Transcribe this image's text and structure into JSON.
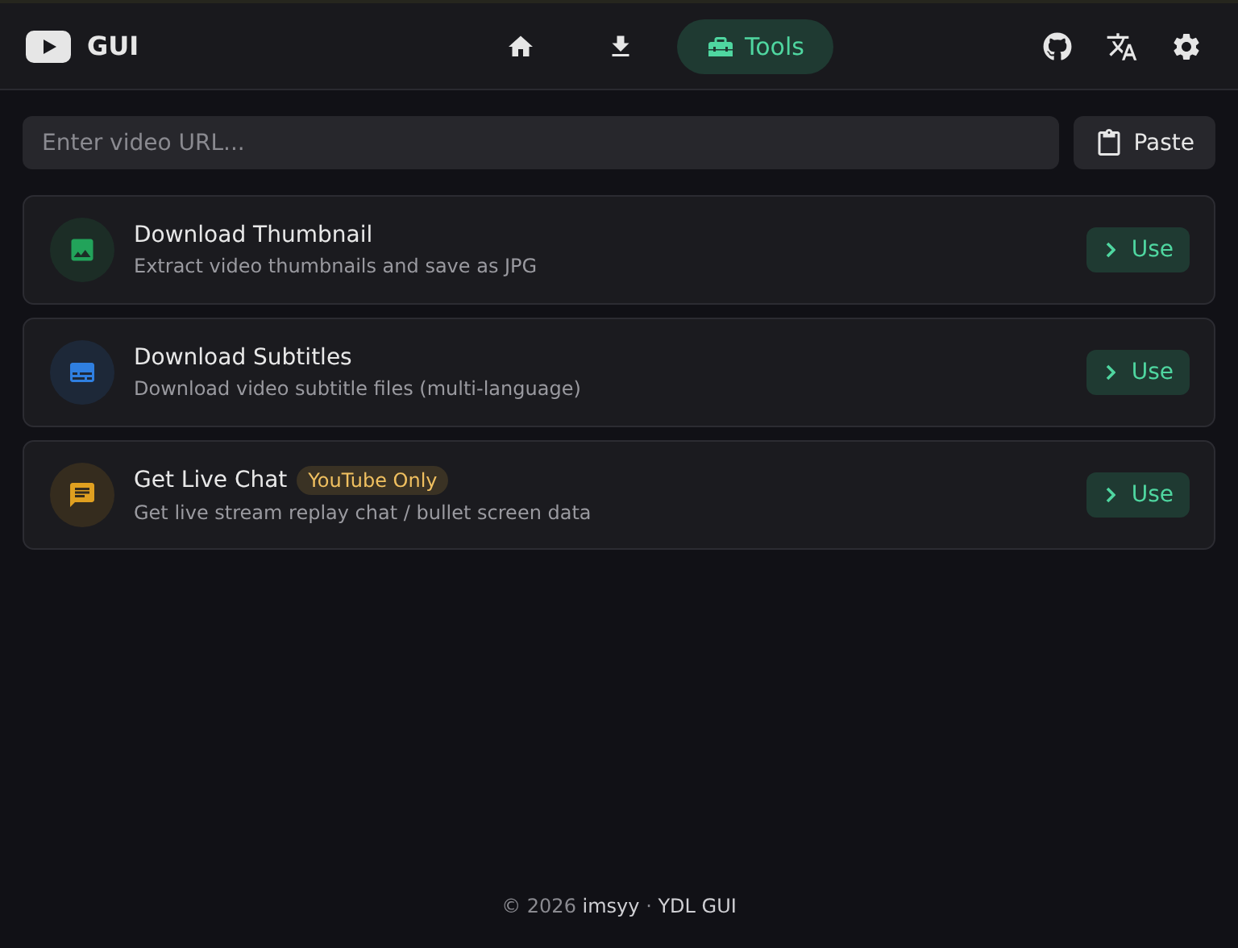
{
  "header": {
    "title": "GUI",
    "nav": [
      {
        "kind": "home",
        "selected": false
      },
      {
        "kind": "download",
        "selected": false
      },
      {
        "kind": "tools",
        "label": "Tools",
        "selected": true
      }
    ]
  },
  "url_field": {
    "placeholder": "Enter video URL..."
  },
  "paste_button": "Paste",
  "tools": [
    {
      "kind": "image",
      "color": "#22a35a",
      "title": "Download Thumbnail",
      "description": "Extract video thumbnails and save as JPG",
      "action": "Use"
    },
    {
      "kind": "subtitles",
      "color": "#2f7fe0",
      "title": "Download Subtitles",
      "description": "Download video subtitle files (multi-language)",
      "action": "Use"
    },
    {
      "kind": "chat",
      "color": "#e0a020",
      "title": "Get Live Chat",
      "badge": "YouTube Only",
      "description": "Get live stream replay chat / bullet screen data",
      "action": "Use"
    }
  ],
  "footer": "© 2026 **imsyy** · **YDL GUI**"
}
